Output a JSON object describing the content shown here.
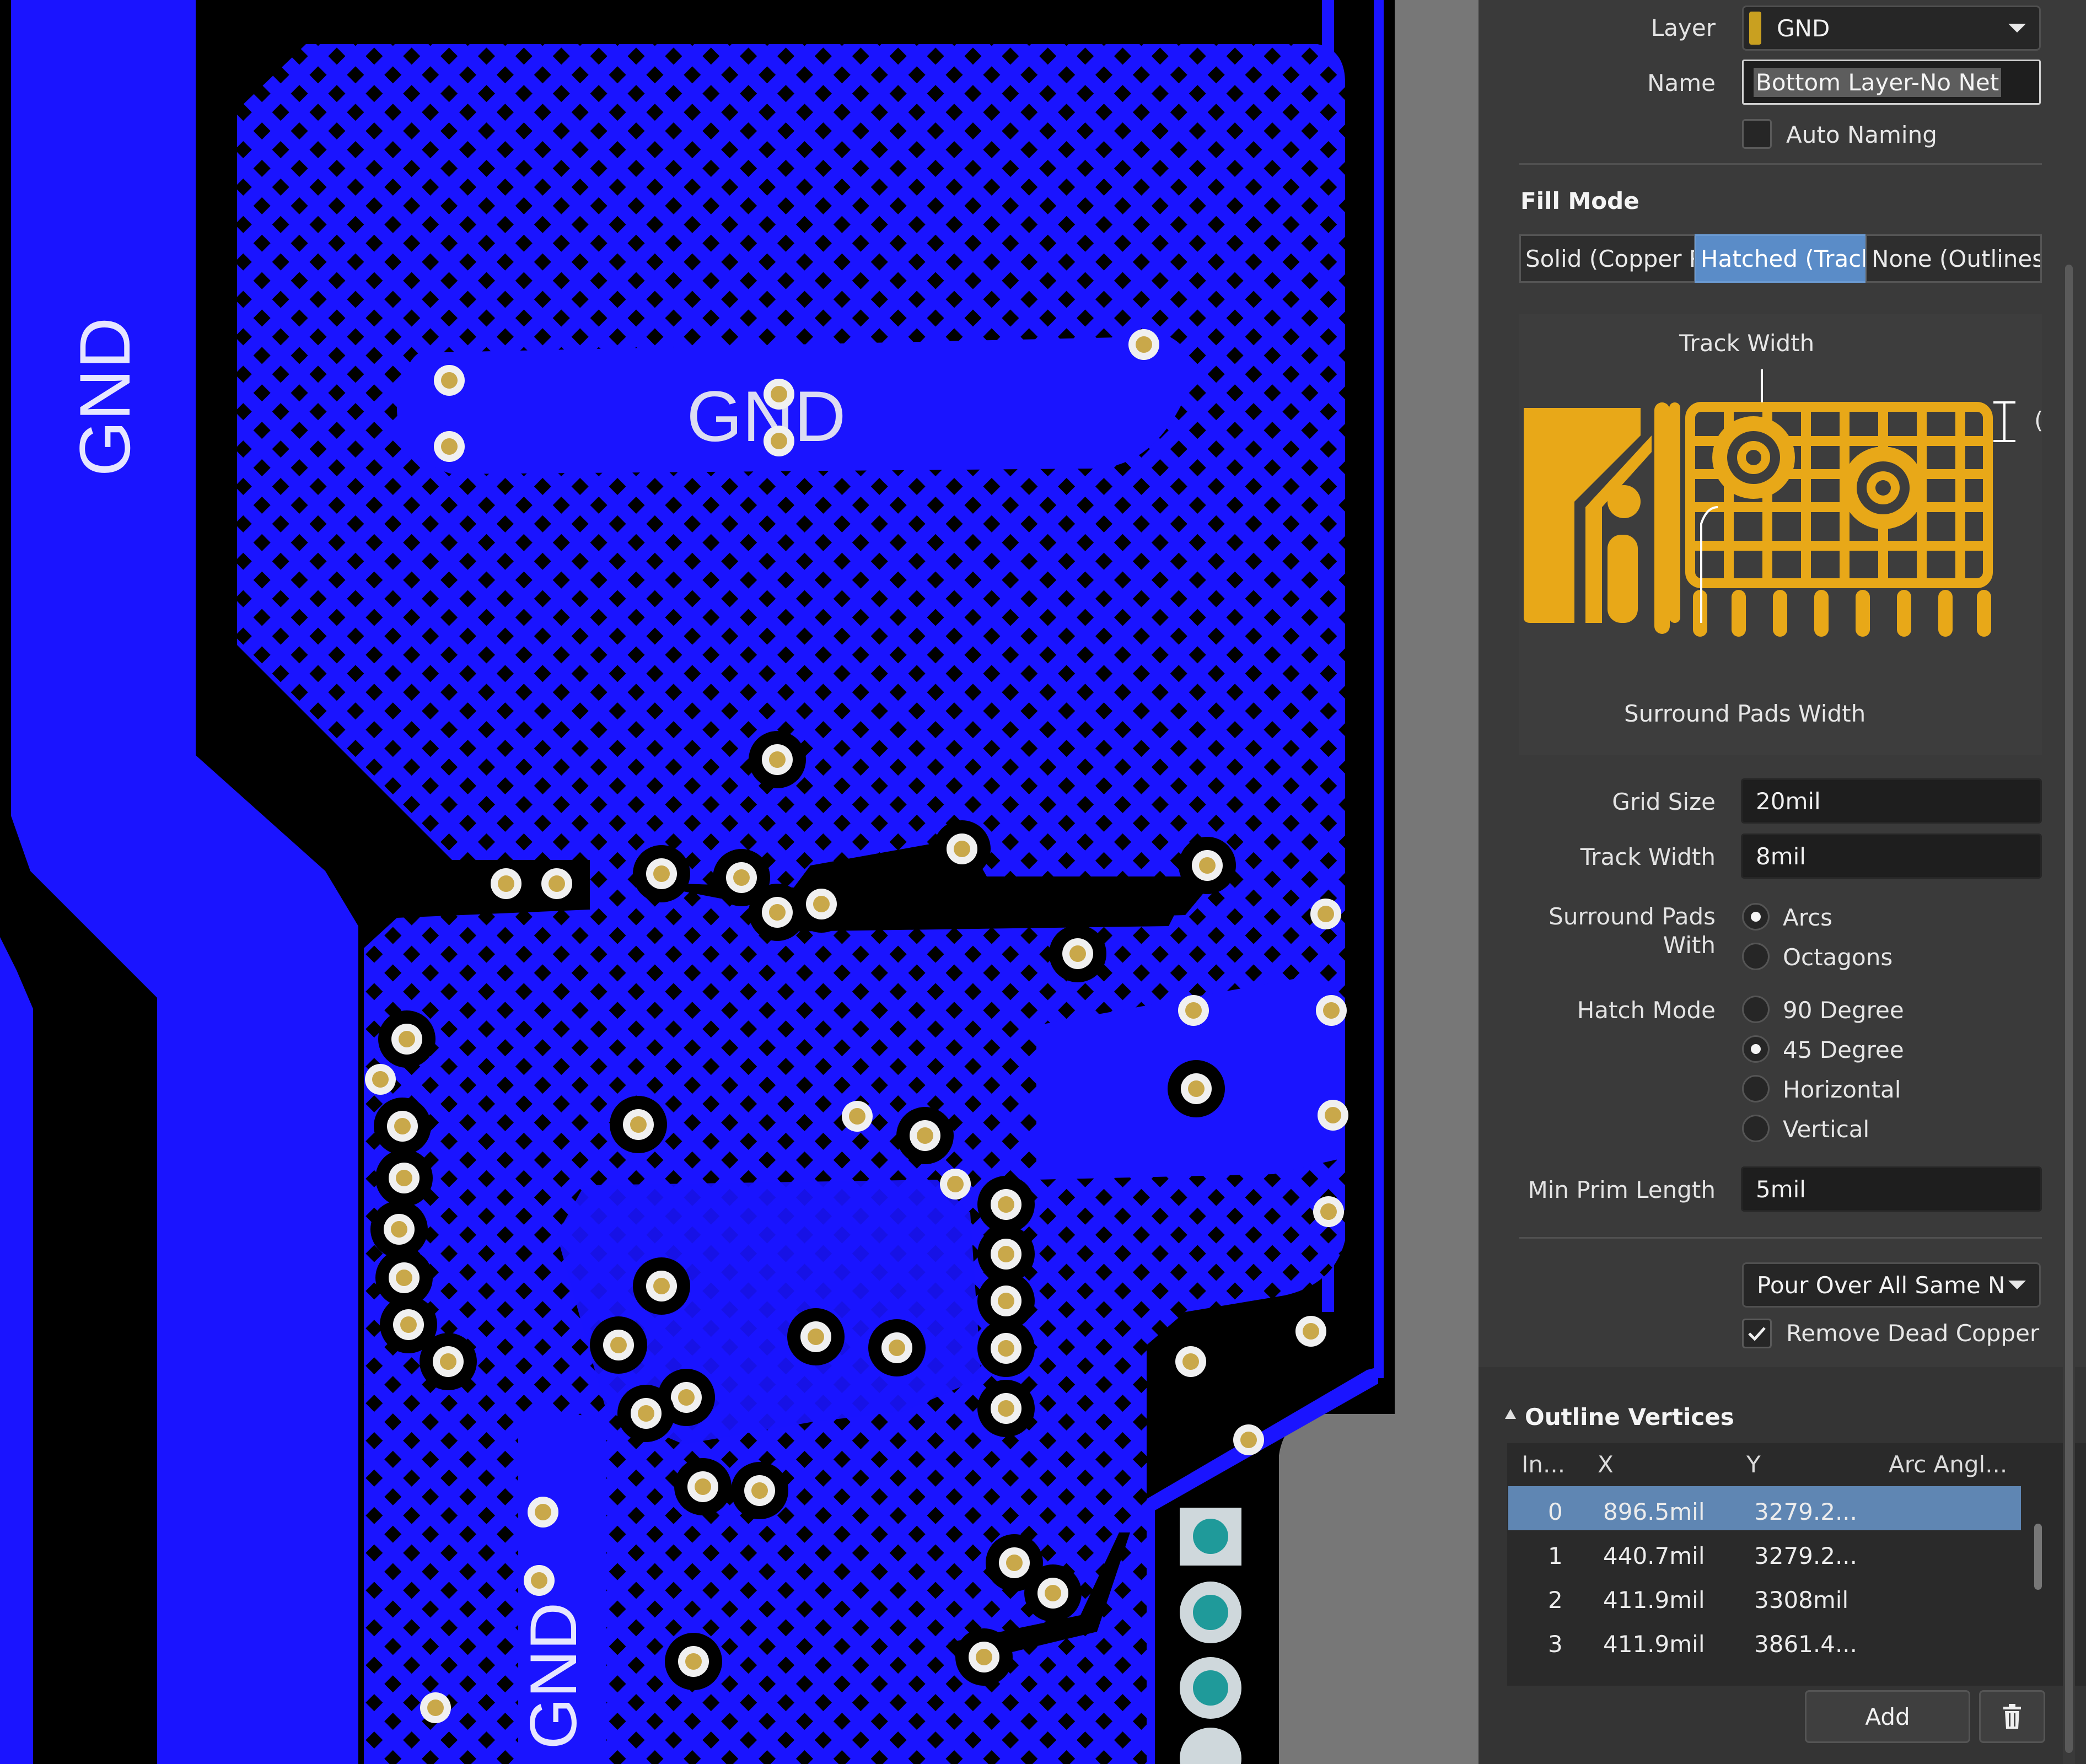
{
  "canvas": {
    "colors": {
      "copper": "#1a14ff",
      "background": "#000000",
      "via_ring": "#c9a84a",
      "via_hole": "#f0f0f0",
      "pad_teal": "#1f9a9a",
      "pad_ring": "#cfd8dc"
    },
    "labels": {
      "gnd_left": "GND",
      "gnd_center": "GND",
      "gnd_bottom": "GND"
    }
  },
  "properties": {
    "layer": {
      "label": "Layer",
      "value": "GND",
      "swatch": "#c9a020"
    },
    "name": {
      "label": "Name",
      "value": "Bottom Layer-No Net"
    },
    "auto_naming": {
      "label": "Auto Naming",
      "checked": false
    },
    "fill_mode": {
      "title": "Fill Mode",
      "options": [
        "Solid (Copper Regions)",
        "Hatched (Tracks/Arcs)",
        "None (Outlines Only)"
      ],
      "selected": "Hatched (Tracks/Arcs)"
    },
    "diagram": {
      "track_width": "Track Width",
      "surround_pads_width": "Surround Pads Width",
      "cut_label": "(",
      "color": "#e8a818"
    },
    "grid_size": {
      "label": "Grid Size",
      "value": "20mil"
    },
    "track_width": {
      "label": "Track Width",
      "value": "8mil"
    },
    "surround_pads": {
      "label_line1": "Surround Pads",
      "label_line2": "With",
      "options": [
        "Arcs",
        "Octagons"
      ],
      "selected": "Arcs"
    },
    "hatch_mode": {
      "label": "Hatch Mode",
      "options": [
        "90 Degree",
        "45 Degree",
        "Horizontal",
        "Vertical"
      ],
      "selected": "45 Degree"
    },
    "min_prim_length": {
      "label": "Min Prim Length",
      "value": "5mil"
    },
    "pour_over": {
      "value": "Pour Over All Same N"
    },
    "remove_dead_copper": {
      "label": "Remove Dead Copper",
      "checked": true
    },
    "outline_vertices": {
      "title": "Outline Vertices",
      "columns": [
        "In...",
        "X",
        "Y",
        "Arc Angl..."
      ],
      "rows": [
        {
          "index": "0",
          "x": "896.5mil",
          "y": "3279.2...",
          "arc": ""
        },
        {
          "index": "1",
          "x": "440.7mil",
          "y": "3279.2...",
          "arc": ""
        },
        {
          "index": "2",
          "x": "411.9mil",
          "y": "3308mil",
          "arc": ""
        },
        {
          "index": "3",
          "x": "411.9mil",
          "y": "3861.4...",
          "arc": ""
        }
      ],
      "selected_row": 0,
      "add_label": "Add",
      "delete_icon": "trash-icon"
    }
  }
}
